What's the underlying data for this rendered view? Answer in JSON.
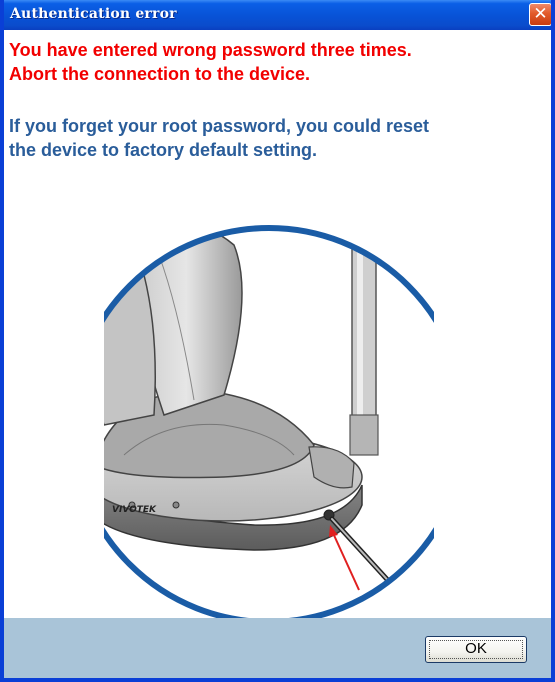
{
  "dialog": {
    "title": "Authentication error",
    "close_glyph": "✕",
    "error_message": {
      "line1": "You have entered wrong password three times.",
      "line2": "Abort the connection to the device."
    },
    "info_message": {
      "line1": "If you forget your root password, you could reset",
      "line2": "the device to factory default setting."
    },
    "illustration": {
      "brand": "VIVOTEK"
    },
    "ok_label": "OK"
  },
  "colors": {
    "titlebar": "#0852d6",
    "error_text": "#f20000",
    "info_text": "#2a5d9a",
    "footer": "#a9c4d8",
    "circle_border": "#1a5ca6",
    "arrow": "#e02020"
  },
  "icons": {
    "close": "close-icon"
  }
}
